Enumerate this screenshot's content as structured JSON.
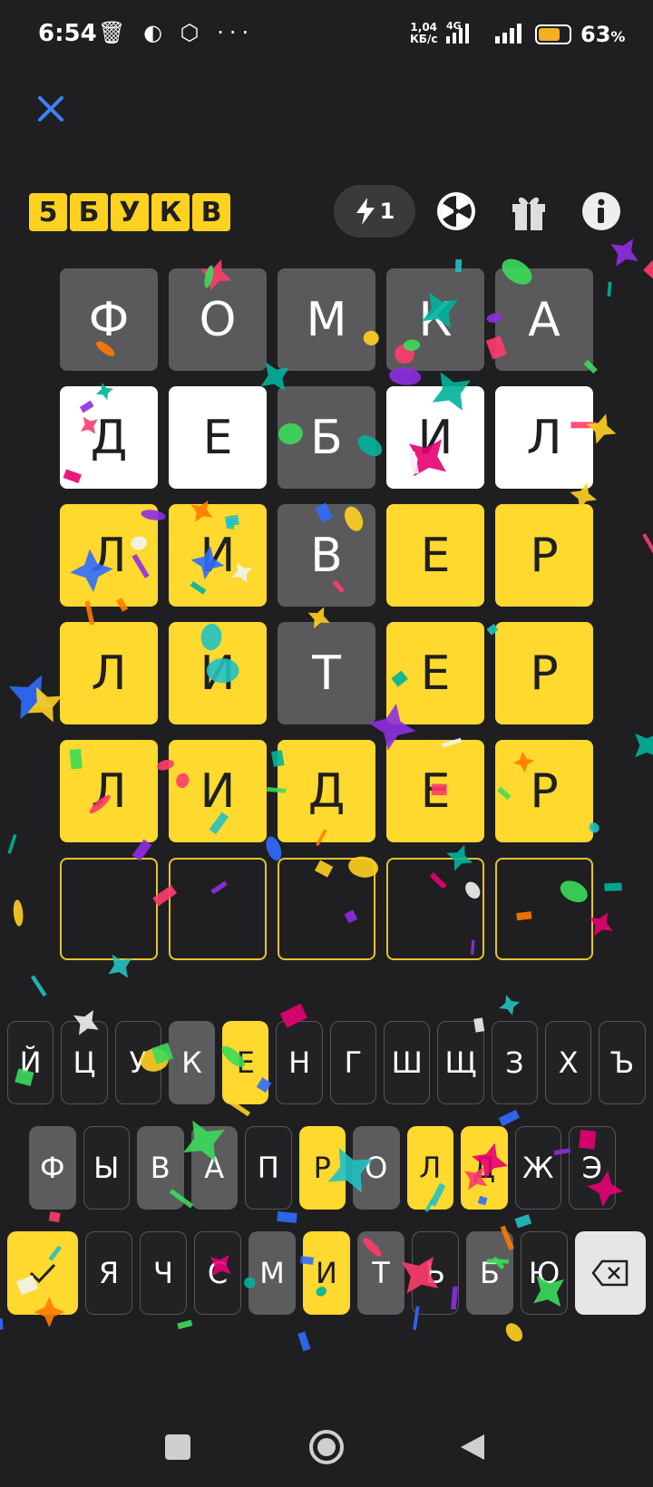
{
  "status_bar": {
    "time": "6:54",
    "icons": "🗑 ◐ ⬡ ···",
    "network_speed_top": "1,04",
    "network_speed_bottom": "КБ/с",
    "network_type": "4G",
    "battery_percent": "63",
    "battery_percent_sign": "%"
  },
  "header": {
    "logo_letters": [
      "5",
      "Б",
      "У",
      "К",
      "В"
    ],
    "hints_count": "1"
  },
  "board": {
    "rows": [
      [
        {
          "letter": "Ф",
          "state": "gray"
        },
        {
          "letter": "О",
          "state": "gray"
        },
        {
          "letter": "М",
          "state": "gray"
        },
        {
          "letter": "К",
          "state": "gray"
        },
        {
          "letter": "А",
          "state": "gray"
        }
      ],
      [
        {
          "letter": "Д",
          "state": "white"
        },
        {
          "letter": "Е",
          "state": "white"
        },
        {
          "letter": "Б",
          "state": "gray"
        },
        {
          "letter": "И",
          "state": "white"
        },
        {
          "letter": "Л",
          "state": "white"
        }
      ],
      [
        {
          "letter": "Л",
          "state": "yellow"
        },
        {
          "letter": "И",
          "state": "yellow"
        },
        {
          "letter": "В",
          "state": "gray"
        },
        {
          "letter": "Е",
          "state": "yellow"
        },
        {
          "letter": "Р",
          "state": "yellow"
        }
      ],
      [
        {
          "letter": "Л",
          "state": "yellow"
        },
        {
          "letter": "И",
          "state": "yellow"
        },
        {
          "letter": "Т",
          "state": "gray"
        },
        {
          "letter": "Е",
          "state": "yellow"
        },
        {
          "letter": "Р",
          "state": "yellow"
        }
      ],
      [
        {
          "letter": "Л",
          "state": "yellow"
        },
        {
          "letter": "И",
          "state": "yellow"
        },
        {
          "letter": "Д",
          "state": "yellow"
        },
        {
          "letter": "Е",
          "state": "yellow"
        },
        {
          "letter": "Р",
          "state": "yellow"
        }
      ],
      [
        {
          "letter": "",
          "state": "empty"
        },
        {
          "letter": "",
          "state": "empty"
        },
        {
          "letter": "",
          "state": "empty"
        },
        {
          "letter": "",
          "state": "empty"
        },
        {
          "letter": "",
          "state": "empty"
        }
      ]
    ]
  },
  "keyboard": {
    "row1": [
      {
        "k": "Й",
        "s": "normal"
      },
      {
        "k": "Ц",
        "s": "normal"
      },
      {
        "k": "У",
        "s": "normal"
      },
      {
        "k": "К",
        "s": "gray"
      },
      {
        "k": "Е",
        "s": "yellow"
      },
      {
        "k": "Н",
        "s": "normal"
      },
      {
        "k": "Г",
        "s": "normal"
      },
      {
        "k": "Ш",
        "s": "normal"
      },
      {
        "k": "Щ",
        "s": "normal"
      },
      {
        "k": "З",
        "s": "normal"
      },
      {
        "k": "Х",
        "s": "normal"
      },
      {
        "k": "Ъ",
        "s": "normal"
      }
    ],
    "row2": [
      {
        "k": "Ф",
        "s": "gray"
      },
      {
        "k": "Ы",
        "s": "normal"
      },
      {
        "k": "В",
        "s": "gray"
      },
      {
        "k": "А",
        "s": "gray"
      },
      {
        "k": "П",
        "s": "normal"
      },
      {
        "k": "Р",
        "s": "yellow"
      },
      {
        "k": "О",
        "s": "gray"
      },
      {
        "k": "Л",
        "s": "yellow"
      },
      {
        "k": "Д",
        "s": "yellow"
      },
      {
        "k": "Ж",
        "s": "normal"
      },
      {
        "k": "Э",
        "s": "normal"
      }
    ],
    "row3": [
      {
        "k": "Я",
        "s": "normal"
      },
      {
        "k": "Ч",
        "s": "normal"
      },
      {
        "k": "С",
        "s": "normal"
      },
      {
        "k": "М",
        "s": "gray"
      },
      {
        "k": "И",
        "s": "yellow"
      },
      {
        "k": "Т",
        "s": "gray"
      },
      {
        "k": "Ь",
        "s": "normal"
      },
      {
        "k": "Б",
        "s": "gray"
      },
      {
        "k": "Ю",
        "s": "normal"
      }
    ]
  },
  "colors": {
    "background": "#1f1f21",
    "present": "#ffd92e",
    "absent": "#5a5a5c",
    "correct_white": "#ffffff",
    "accent_blue": "#3b82f6"
  },
  "icons": {
    "close": "close-icon",
    "hint": "lightning-icon",
    "wheel": "wheel-icon",
    "gift": "gift-icon",
    "info": "info-icon",
    "enter": "checkmark-icon",
    "backspace": "backspace-icon"
  }
}
